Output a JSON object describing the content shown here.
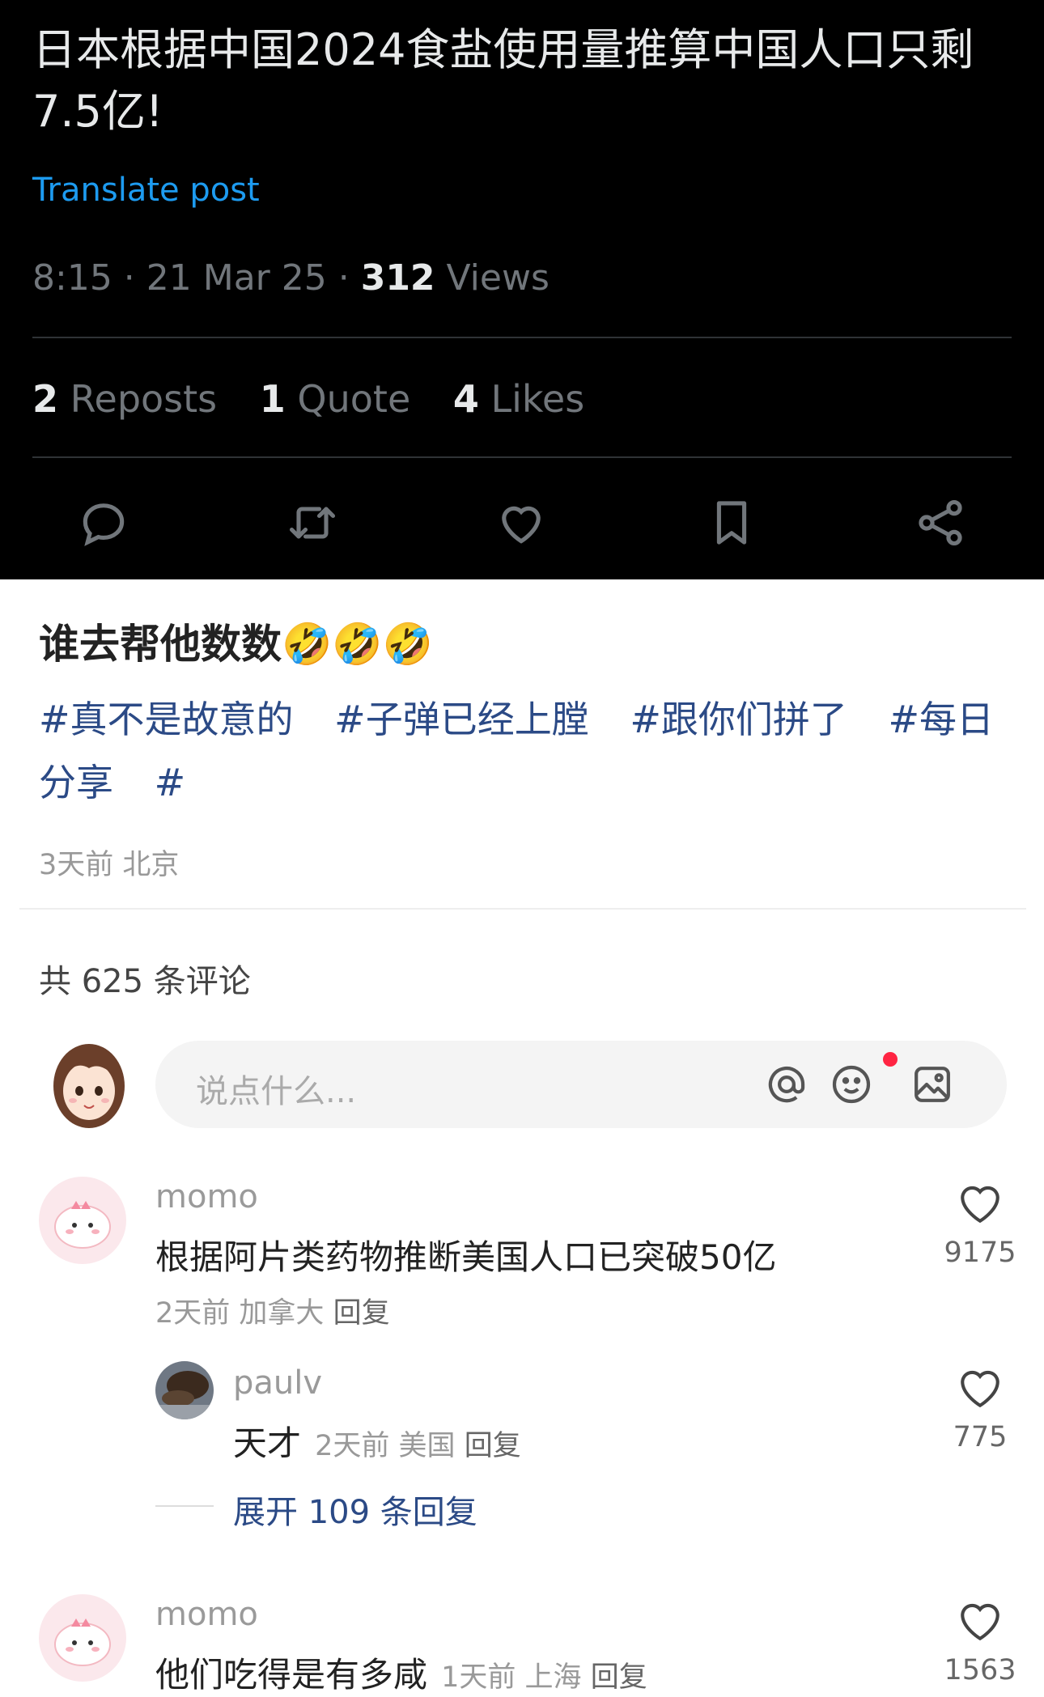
{
  "tweet": {
    "title": "日本根据中国2024食盐使用量推算中国人口只剩7.5亿!",
    "translate": "Translate post",
    "time": "8:15 · 21 Mar 25 · ",
    "views_count": "312",
    "views_label": " Views",
    "stats": [
      {
        "n": "2",
        "label": " Reposts"
      },
      {
        "n": "1",
        "label": " Quote"
      },
      {
        "n": "4",
        "label": " Likes"
      }
    ],
    "actions": [
      "reply-icon",
      "retweet-icon",
      "heart-icon",
      "bookmark-icon",
      "share-icon"
    ]
  },
  "post": {
    "caption": "谁去帮他数数🤣🤣🤣",
    "tags": [
      "#真不是故意的",
      "#子弹已经上膛",
      "#跟你们拼了",
      "#每日分享",
      "#"
    ],
    "time_location": "3天前 北京"
  },
  "comments_section": {
    "count_text": "共 625 条评论",
    "input_placeholder": "说点什么...",
    "input_icons": [
      "at-icon",
      "emoji-icon",
      "image-icon"
    ]
  },
  "comments": [
    {
      "user": "momo",
      "text": "根据阿片类药物推断美国人口已突破50亿",
      "time": "2天前",
      "location": "加拿大",
      "reply": "回复",
      "likes": "9175"
    },
    {
      "user": "paulv",
      "text": "天才",
      "time": "2天前",
      "location": "美国",
      "reply": "回复",
      "likes": "775"
    },
    {
      "user": "momo",
      "text": "他们吃得是有多咸",
      "time": "1天前",
      "location": "上海",
      "reply": "回复",
      "likes": "1563"
    }
  ],
  "expand_replies": "展开 109 条回复",
  "colors": {
    "link_blue": "#1d9bf0",
    "tag_blue": "#2b4a86",
    "notification_red": "#ff2442"
  }
}
